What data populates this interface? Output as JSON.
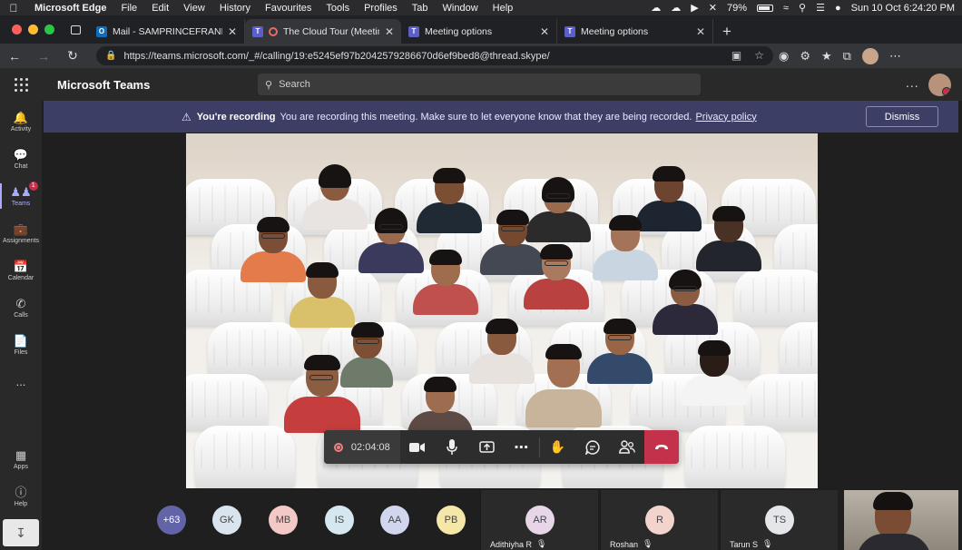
{
  "menubar": {
    "app": "Microsoft Edge",
    "items": [
      "File",
      "Edit",
      "View",
      "History",
      "Favourites",
      "Tools",
      "Profiles",
      "Tab",
      "Window",
      "Help"
    ],
    "battery": "79%",
    "datetime": "Sun 10 Oct  6:24:20 PM"
  },
  "tabs": [
    {
      "label": "Mail - SAMPRINCEFRANKLIN",
      "icon": "outlook-icon",
      "active": false
    },
    {
      "label": "The Cloud Tour (Meeting)",
      "icon": "teams-icon",
      "active": true
    },
    {
      "label": "Meeting options",
      "icon": "teams-icon",
      "active": false
    },
    {
      "label": "Meeting options",
      "icon": "teams-icon",
      "active": false
    }
  ],
  "address": {
    "url": "https://teams.microsoft.com/_#/calling/19:e5245ef97b2042579286670d6ef9bed8@thread.skype/"
  },
  "teams": {
    "app_name": "Microsoft Teams",
    "search_placeholder": "Search",
    "more": "..."
  },
  "rail": [
    {
      "label": "Activity",
      "icon": "bell-icon"
    },
    {
      "label": "Chat",
      "icon": "chat-icon"
    },
    {
      "label": "Teams",
      "icon": "teams-people-icon",
      "active": true,
      "badge": "1"
    },
    {
      "label": "Assignments",
      "icon": "assignments-icon"
    },
    {
      "label": "Calendar",
      "icon": "calendar-icon"
    },
    {
      "label": "Calls",
      "icon": "phone-icon"
    },
    {
      "label": "Files",
      "icon": "file-icon"
    },
    {
      "label": "...",
      "icon": "more-icon"
    },
    {
      "label": "Apps",
      "icon": "apps-icon"
    },
    {
      "label": "Help",
      "icon": "help-icon"
    }
  ],
  "recording_banner": {
    "title": "You're recording",
    "message": "You are recording this meeting. Make sure to let everyone know that they are being recorded.",
    "link": "Privacy policy",
    "dismiss": "Dismiss"
  },
  "toolbar": {
    "timer": "02:04:08"
  },
  "participants_strip": {
    "overflow": "+63",
    "chips": [
      {
        "initials": "GK",
        "color": "#d9e4ef"
      },
      {
        "initials": "MB",
        "color": "#f2c9c6"
      },
      {
        "initials": "IS",
        "color": "#d5e8f0"
      },
      {
        "initials": "AA",
        "color": "#cfd6ee"
      },
      {
        "initials": "PB",
        "color": "#f5e7a8"
      }
    ],
    "named": [
      {
        "initials": "AR",
        "name": "Adithiyha R",
        "color": "#e7d6e7"
      },
      {
        "initials": "R",
        "name": "Roshan",
        "color": "#f2d4cc"
      },
      {
        "initials": "TS",
        "name": "Tarun S",
        "color": "#e4e6ea"
      }
    ]
  }
}
